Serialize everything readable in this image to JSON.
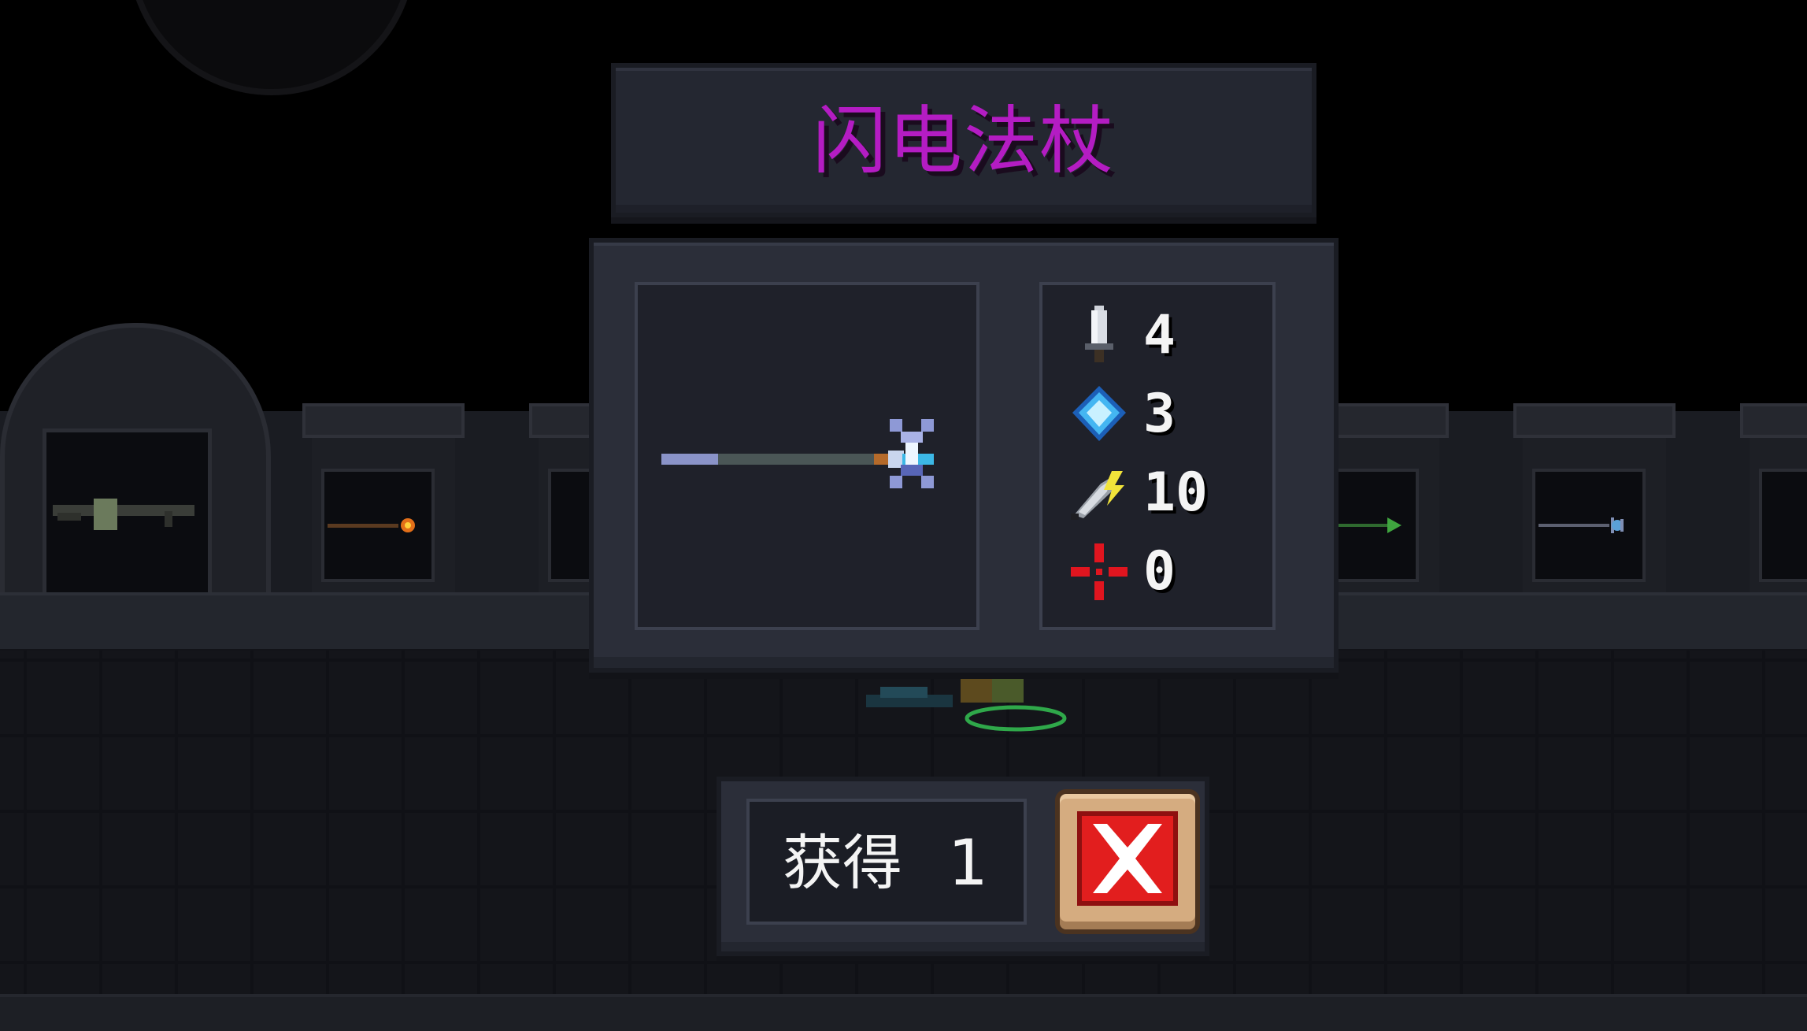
{
  "dialog": {
    "item_name": "闪电法杖",
    "item_name_color": "#b41cc3"
  },
  "stats": [
    {
      "icon": "dagger-damage-icon",
      "value": "4"
    },
    {
      "icon": "blue-gem-energy-icon",
      "value": "3"
    },
    {
      "icon": "lightning-feather-crit-icon",
      "value": "10"
    },
    {
      "icon": "red-crosshair-accuracy-icon",
      "value": "0"
    }
  ],
  "obtain": {
    "label": "获得",
    "count": "1"
  },
  "close_button": {
    "icon": "close-x-icon",
    "color": "#e21e1e"
  },
  "colors": {
    "panel": "#2b2e39",
    "panel_inset": "#1f212a",
    "text": "#f4f4f4",
    "button_frame": "#d5ac80"
  }
}
